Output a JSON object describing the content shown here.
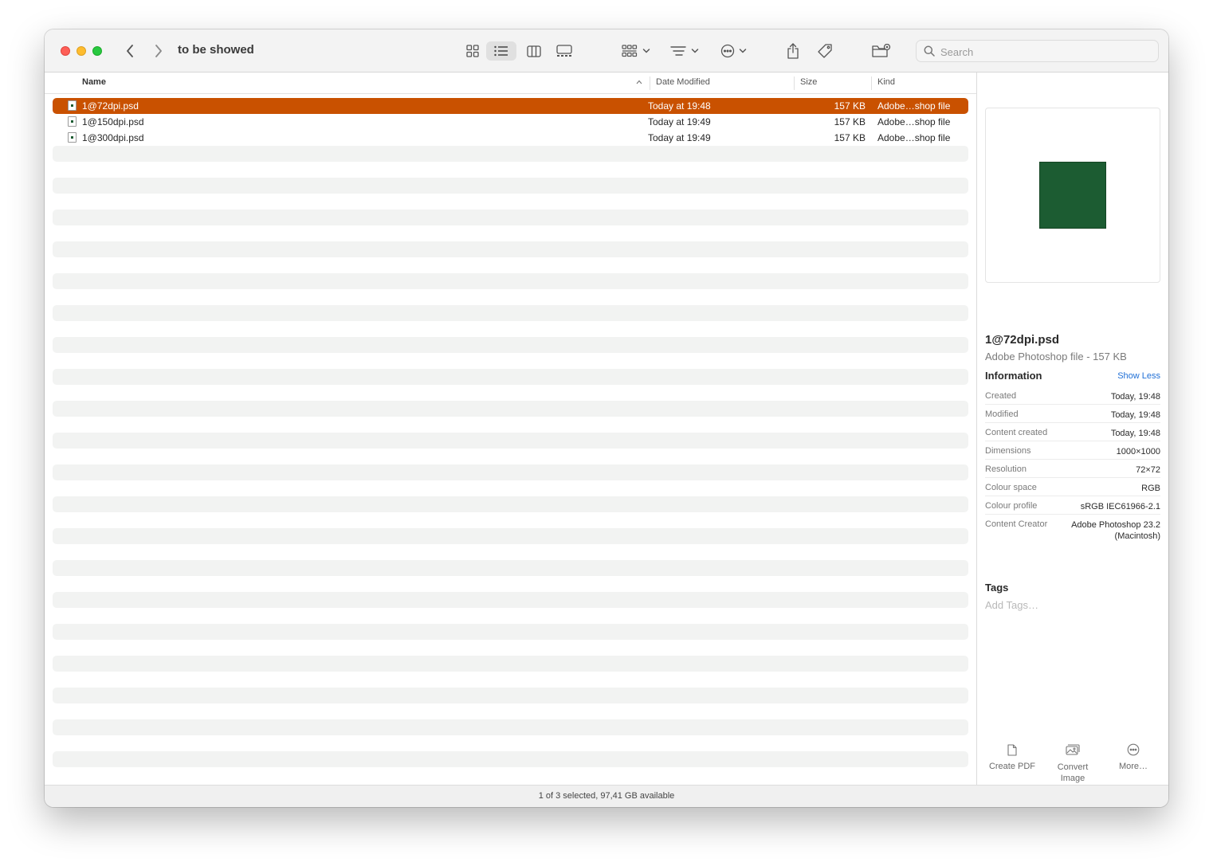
{
  "window": {
    "title": "to be showed"
  },
  "search": {
    "placeholder": "Search"
  },
  "columns": {
    "name": "Name",
    "date": "Date Modified",
    "size": "Size",
    "kind": "Kind"
  },
  "files": [
    {
      "name": "1@72dpi.psd",
      "date": "Today at 19:48",
      "size": "157 KB",
      "kind": "Adobe…shop file",
      "selected": true
    },
    {
      "name": "1@150dpi.psd",
      "date": "Today at 19:49",
      "size": "157 KB",
      "kind": "Adobe…shop file",
      "selected": false
    },
    {
      "name": "1@300dpi.psd",
      "date": "Today at 19:49",
      "size": "157 KB",
      "kind": "Adobe…shop file",
      "selected": false
    }
  ],
  "preview": {
    "name": "1@72dpi.psd",
    "subtitle": "Adobe Photoshop file - 157 KB",
    "info_title": "Information",
    "show_less": "Show Less",
    "info": [
      {
        "key": "Created",
        "value": "Today, 19:48"
      },
      {
        "key": "Modified",
        "value": "Today, 19:48"
      },
      {
        "key": "Content created",
        "value": "Today, 19:48"
      },
      {
        "key": "Dimensions",
        "value": "1000×1000"
      },
      {
        "key": "Resolution",
        "value": "72×72"
      },
      {
        "key": "Colour space",
        "value": "RGB"
      },
      {
        "key": "Colour profile",
        "value": "sRGB IEC61966-2.1"
      },
      {
        "key": "Content Creator",
        "value": "Adobe Photoshop 23.2\n(Macintosh)"
      }
    ],
    "tags_title": "Tags",
    "tags_placeholder": "Add Tags…",
    "actions": {
      "create_pdf": "Create PDF",
      "convert_image": "Convert\nImage",
      "more": "More…"
    }
  },
  "status": "1 of 3 selected, 97,41 GB available",
  "colors": {
    "selection": "#c95100",
    "thumbnail": "#1c5c32",
    "link": "#1f6fd6"
  }
}
